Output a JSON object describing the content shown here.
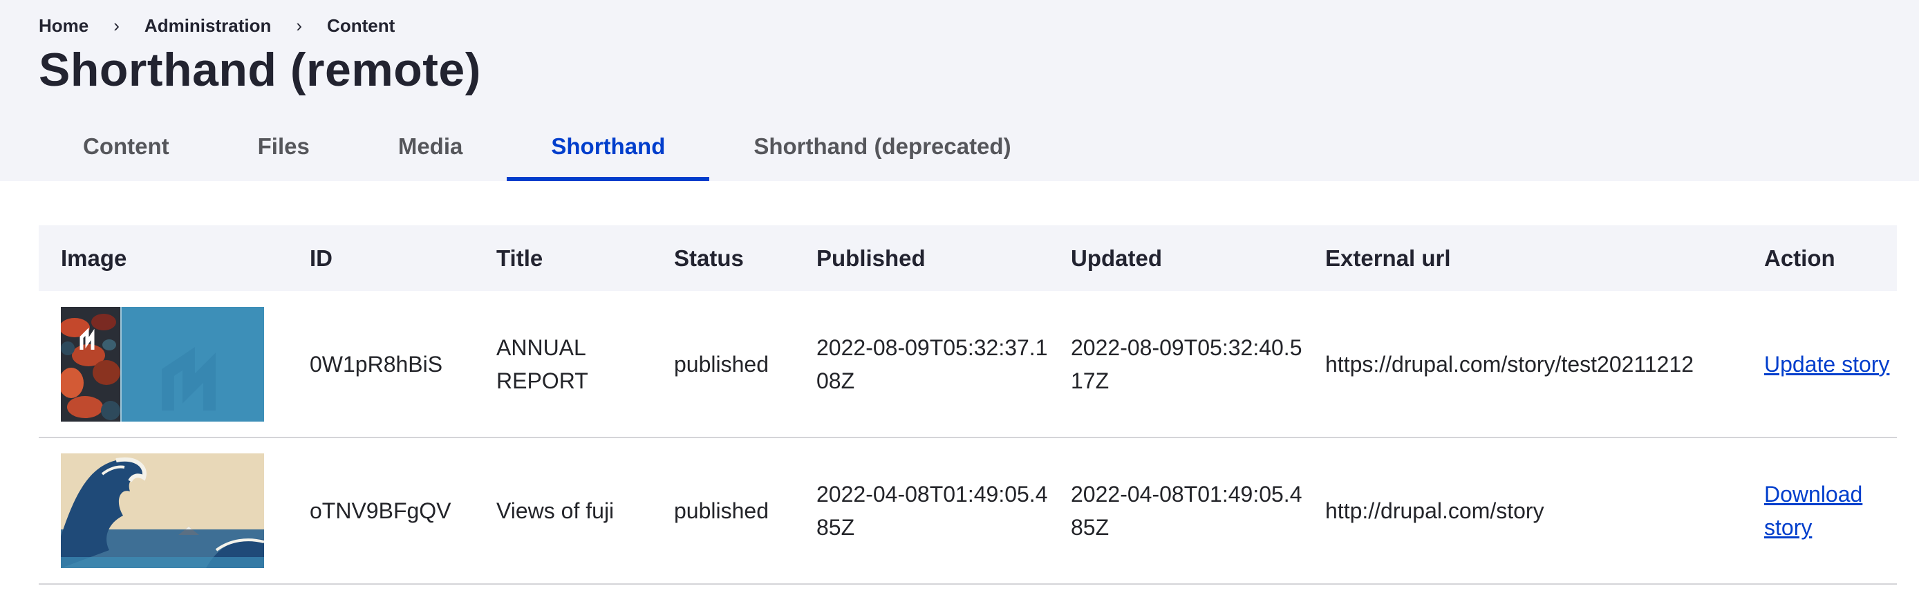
{
  "breadcrumb": [
    "Home",
    "Administration",
    "Content"
  ],
  "breadcrumb_separator": "›",
  "page_title": "Shorthand (remote)",
  "tabs": [
    {
      "label": "Content",
      "active": false
    },
    {
      "label": "Files",
      "active": false
    },
    {
      "label": "Media",
      "active": false
    },
    {
      "label": "Shorthand",
      "active": true
    },
    {
      "label": "Shorthand (deprecated)",
      "active": false
    }
  ],
  "table": {
    "columns": [
      "Image",
      "ID",
      "Title",
      "Status",
      "Published",
      "Updated",
      "External url",
      "Action"
    ],
    "rows": [
      {
        "image": "annual-report-thumbnail",
        "id": "0W1pR8hBiS",
        "title": "ANNUAL REPORT",
        "status": "published",
        "published": "2022-08-09T05:32:37.108Z",
        "updated": "2022-08-09T05:32:40.517Z",
        "external_url": "https://drupal.com/story/test20211212",
        "action": "Update story"
      },
      {
        "image": "great-wave-thumbnail",
        "id": "oTNV9BFgQV",
        "title": "Views of fuji",
        "status": "published",
        "published": "2022-04-08T01:49:05.485Z",
        "updated": "2022-04-08T01:49:05.485Z",
        "external_url": "http://drupal.com/story",
        "action": "Download story"
      }
    ]
  },
  "colors": {
    "accent": "#003ecc",
    "header_bg": "#f3f4f9",
    "text": "#232429"
  }
}
